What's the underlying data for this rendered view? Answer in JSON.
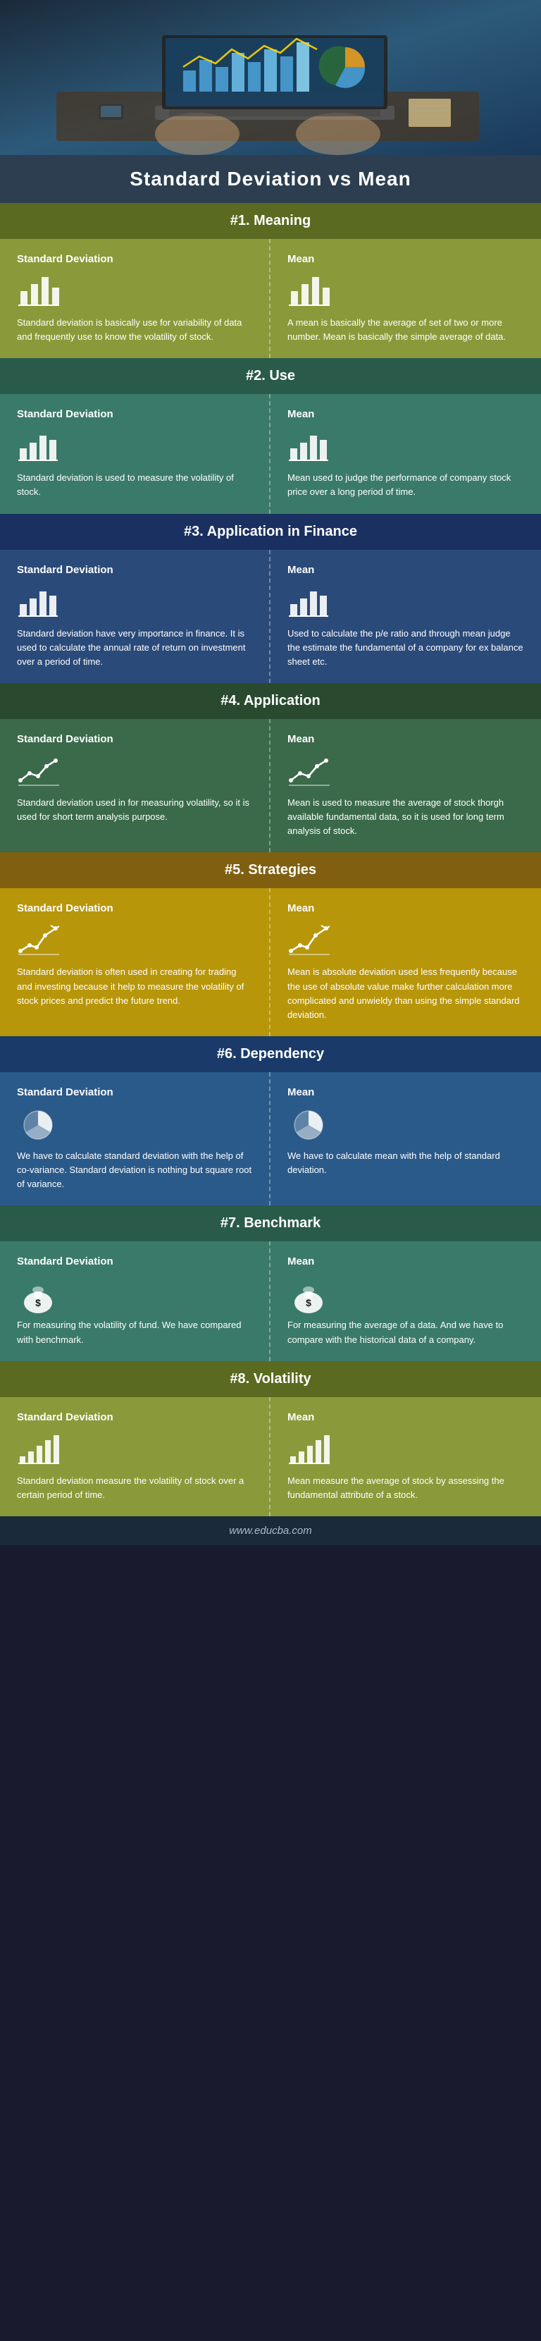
{
  "hero": {
    "alt": "Person working on laptop with charts"
  },
  "page": {
    "title": "Standard Deviation vs Mean",
    "footer": "www.educba.com"
  },
  "sections": [
    {
      "id": "meaning",
      "number": "#1. Meaning",
      "bg": "olive",
      "left": {
        "header": "Standard Deviation",
        "icon": "bar-chart",
        "body": "Standard deviation is basically use for variability of data and frequently use to know the volatility of stock."
      },
      "right": {
        "header": "Mean",
        "icon": "bar-chart",
        "body": "A mean is basically the average of set of two or more number. Mean is basically the simple average of data."
      }
    },
    {
      "id": "use",
      "number": "#2. Use",
      "bg": "teal",
      "left": {
        "header": "Standard Deviation",
        "icon": "bar-chart-small",
        "body": "Standard deviation is used to measure the volatility of stock."
      },
      "right": {
        "header": "Mean",
        "icon": "bar-chart-small",
        "body": "Mean used to judge the performance of company stock price over a long period of time."
      }
    },
    {
      "id": "application-finance",
      "number": "#3. Application in Finance",
      "bg": "blue-dark",
      "left": {
        "header": "Standard Deviation",
        "icon": "bar-chart-small",
        "body": "Standard deviation have very importance in finance. It is used to calculate the annual rate of return on investment over a period of time."
      },
      "right": {
        "header": "Mean",
        "icon": "bar-chart-small",
        "body": "Used to calculate the p/e ratio and through mean judge the estimate the fundamental of a company for ex balance sheet etc."
      }
    },
    {
      "id": "application",
      "number": "#4. Application",
      "bg": "green-dark",
      "left": {
        "header": "Standard Deviation",
        "icon": "line-chart",
        "body": "Standard deviation used in for measuring volatility, so it is used for short term analysis purpose."
      },
      "right": {
        "header": "Mean",
        "icon": "line-chart",
        "body": "Mean is used to measure the average of stock thorgh available fundamental data, so it is used for long term analysis of stock."
      }
    },
    {
      "id": "strategies",
      "number": "#5. Strategies",
      "bg": "gold",
      "left": {
        "header": "Standard Deviation",
        "icon": "line-chart-up",
        "body": "Standard deviation is often used in creating for trading and investing because it help to measure the volatility of stock prices and predict the future trend."
      },
      "right": {
        "header": "Mean",
        "icon": "line-chart-up",
        "body": "Mean is absolute deviation used less frequently because the use of absolute value make further calculation more complicated and unwieldy than using the simple standard deviation."
      }
    },
    {
      "id": "dependency",
      "number": "#6. Dependency",
      "bg": "medium-blue",
      "left": {
        "header": "Standard Deviation",
        "icon": "pie-chart",
        "body": "We have to calculate standard deviation with the help of co-variance. Standard deviation is nothing but square root of variance."
      },
      "right": {
        "header": "Mean",
        "icon": "pie-chart",
        "body": "We have to calculate mean with the help of standard deviation."
      }
    },
    {
      "id": "benchmark",
      "number": "#7. Benchmark",
      "bg": "teal",
      "left": {
        "header": "Standard Deviation",
        "icon": "money-bag",
        "body": "For measuring the volatility of fund. We have compared with benchmark."
      },
      "right": {
        "header": "Mean",
        "icon": "money-bag",
        "body": "For measuring the average of a data. And we have to compare with the historical data of a company."
      }
    },
    {
      "id": "volatility",
      "number": "#8. Volatility",
      "bg": "olive",
      "left": {
        "header": "Standard Deviation",
        "icon": "bar-chart-up",
        "body": "Standard deviation measure the volatility of stock over a certain period of time."
      },
      "right": {
        "header": "Mean",
        "icon": "bar-chart-up",
        "body": "Mean measure the average of stock by assessing the fundamental attribute of a stock."
      }
    }
  ]
}
